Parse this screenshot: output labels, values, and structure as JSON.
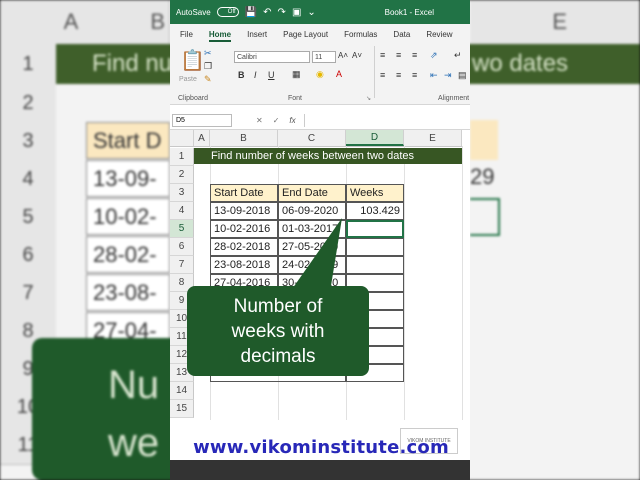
{
  "background": {
    "col_letters": [
      "A",
      "B",
      "E"
    ],
    "row_numbers": [
      "1",
      "2",
      "3",
      "4",
      "5",
      "6",
      "7",
      "8",
      "9",
      "10",
      "11"
    ],
    "title_text": "Find nu",
    "title_text_right": "wo dates",
    "cells": [
      "Start D",
      "13-09-",
      "10-02-",
      "28-02-",
      "23-08-",
      "27-04-"
    ],
    "right_value": "29",
    "big_text": "Nu we"
  },
  "titlebar": {
    "autosave_label": "AutoSave",
    "autosave_state": "Off",
    "doc_title": "Book1 - Excel"
  },
  "menu": [
    "File",
    "Home",
    "Insert",
    "Page Layout",
    "Formulas",
    "Data",
    "Review"
  ],
  "menu_active": "Home",
  "ribbon": {
    "paste_label": "Paste",
    "font_name": "Calibri",
    "font_size": "11",
    "bold": "B",
    "italic": "I",
    "underline": "U",
    "clipboard_label": "Clipboard",
    "font_label": "Font",
    "alignment_label": "Alignment"
  },
  "formula_bar": {
    "name_box": "D5",
    "fx": "fx",
    "value": ""
  },
  "columns": [
    "A",
    "B",
    "C",
    "D",
    "E"
  ],
  "selected_column": "D",
  "rows": [
    "1",
    "2",
    "3",
    "4",
    "5",
    "6",
    "7",
    "8",
    "9",
    "10",
    "11",
    "12",
    "13",
    "14",
    "15"
  ],
  "selected_row": "5",
  "sheet": {
    "title": "Find number of weeks between two dates",
    "headers": [
      "Start Date",
      "End Date",
      "Weeks"
    ],
    "data": [
      [
        "13-09-2018",
        "06-09-2020",
        "103.429"
      ],
      [
        "10-02-2016",
        "01-03-2017",
        ""
      ],
      [
        "28-02-2018",
        "27-05-2019",
        ""
      ],
      [
        "23-08-2018",
        "24-02-2019",
        ""
      ],
      [
        "27-04-2016",
        "30-06-2020",
        ""
      ]
    ]
  },
  "callout": "Number of\nweeks with\ndecimals",
  "watermark_url": "www.vikominstitute.com",
  "watermark_logo": "VIKOM INSTITUTE",
  "colors": {
    "excel_green": "#217346",
    "title_fill": "#375623",
    "header_fill": "#fff2cc",
    "callout_fill": "#1f5a2a",
    "url_color": "#2828b8"
  }
}
